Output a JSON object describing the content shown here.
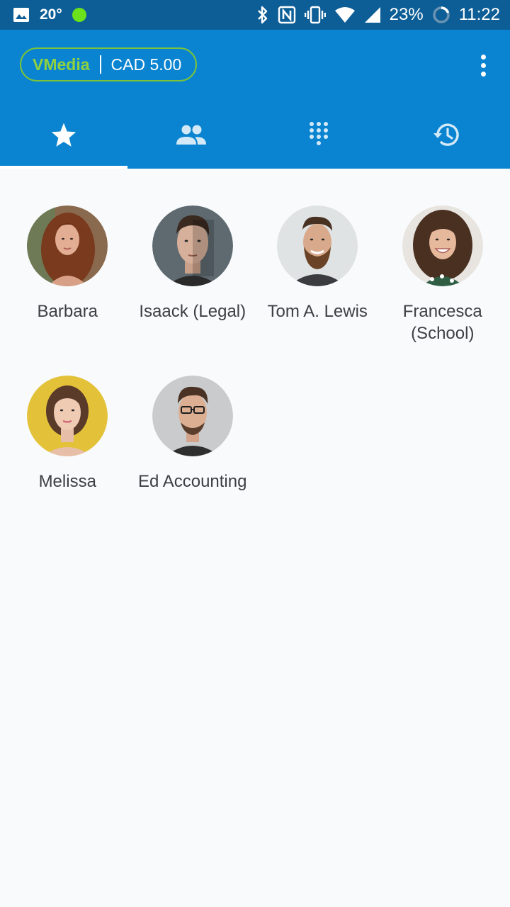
{
  "status_bar": {
    "temperature": "20°",
    "battery": "23%",
    "time": "11:22"
  },
  "header": {
    "brand": "VMedia",
    "balance": "CAD 5.00",
    "accent_color": "#8fd13f",
    "bar_color": "#0a84d0"
  },
  "tabs": [
    {
      "name": "favorites",
      "icon": "star-icon",
      "active": true
    },
    {
      "name": "contacts",
      "icon": "people-icon",
      "active": false
    },
    {
      "name": "dialpad",
      "icon": "dialpad-icon",
      "active": false
    },
    {
      "name": "history",
      "icon": "history-icon",
      "active": false
    }
  ],
  "favorites": [
    {
      "name": "Barbara"
    },
    {
      "name": "Isaack (Legal)"
    },
    {
      "name": "Tom A. Lewis"
    },
    {
      "name": "Francesca (School)"
    },
    {
      "name": "Melissa"
    },
    {
      "name": "Ed Accounting"
    }
  ]
}
